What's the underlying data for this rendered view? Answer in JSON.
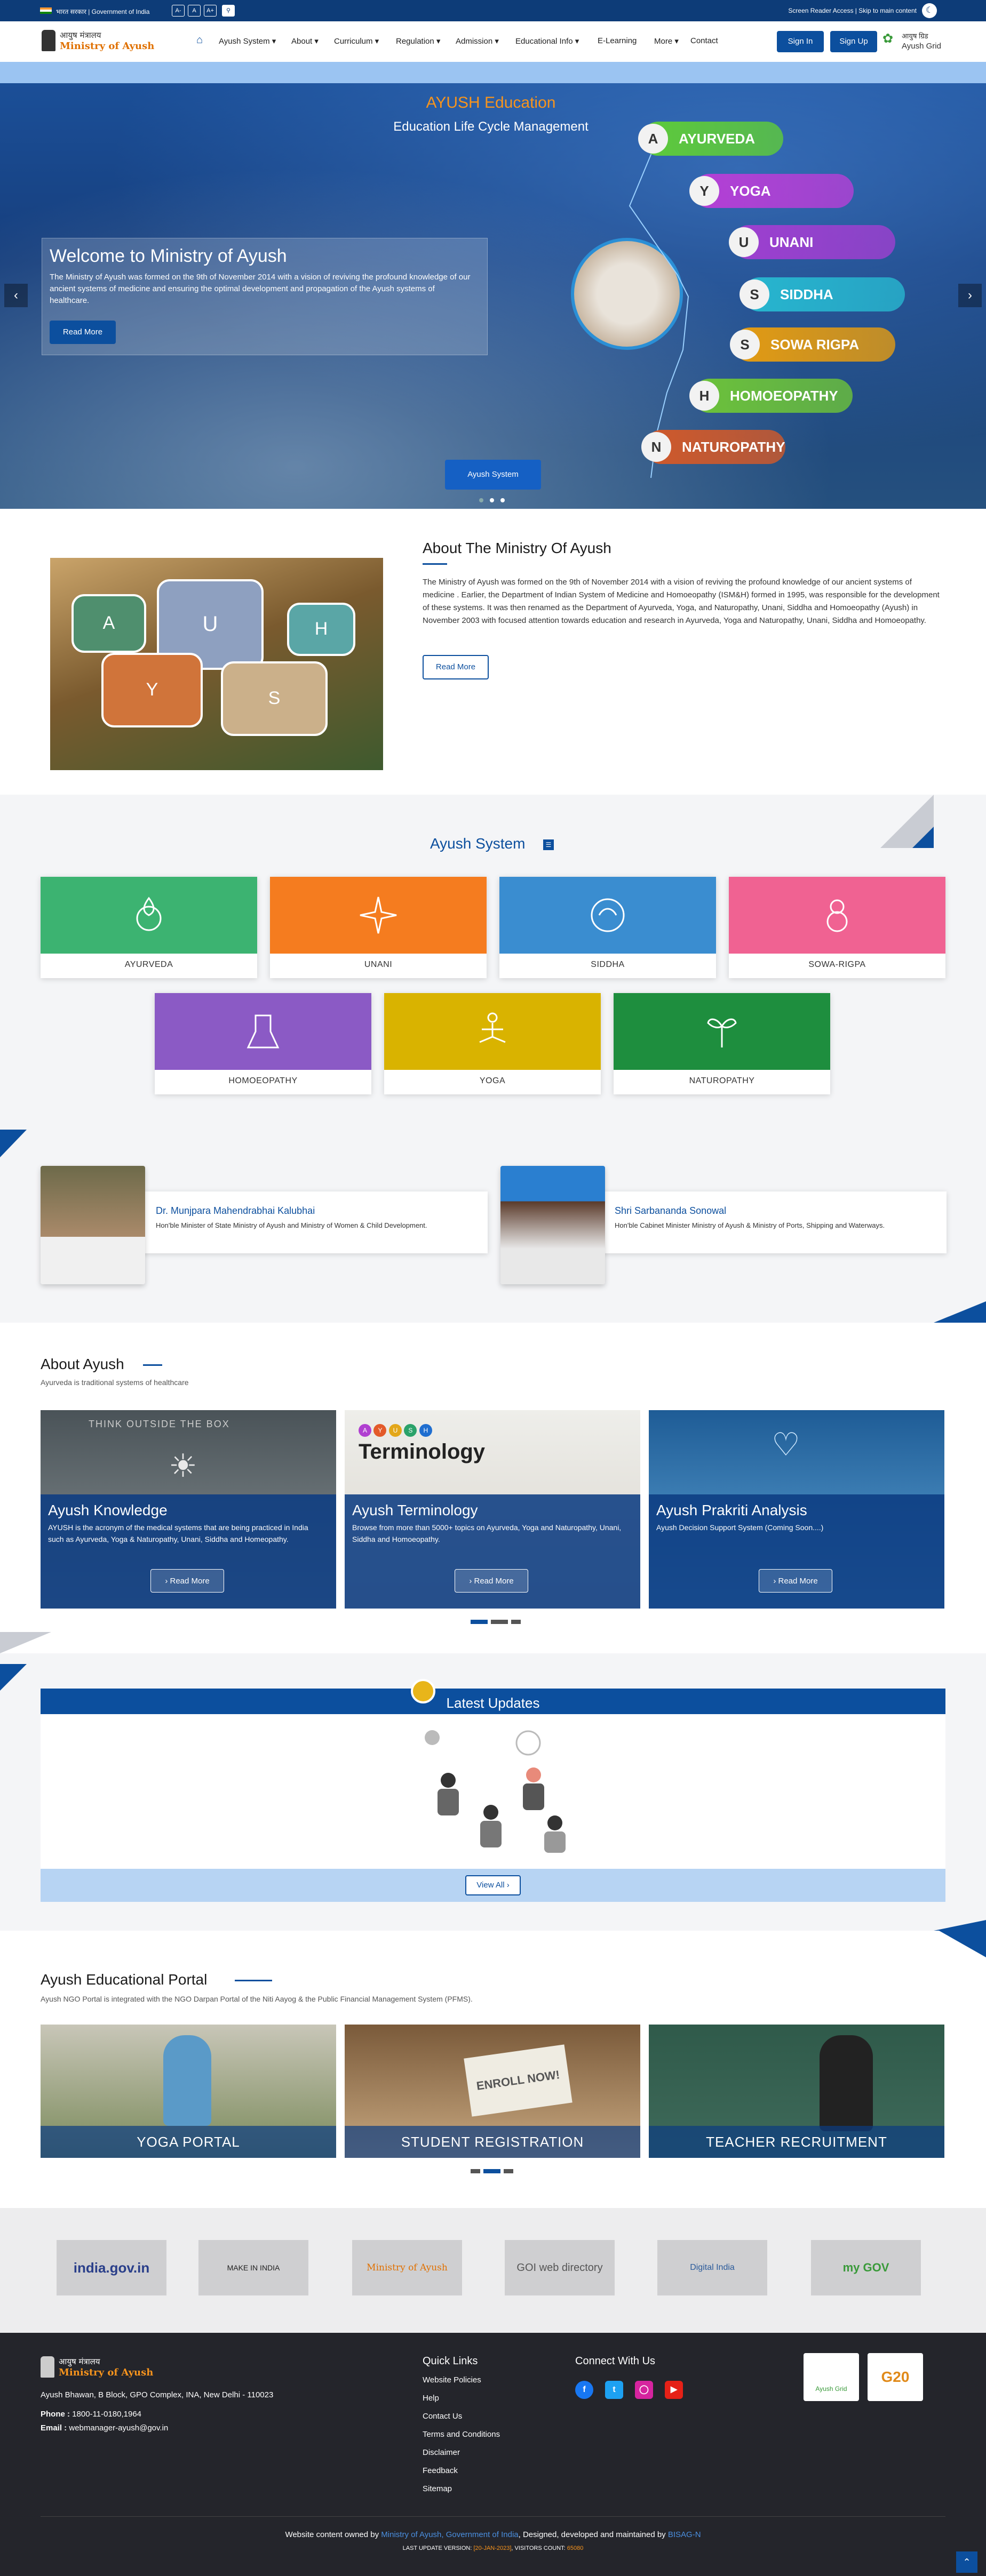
{
  "topbar": {
    "gov_text": "भारत सरकार | Government of India",
    "font_buttons": [
      "A-",
      "A",
      "A+"
    ],
    "screen_reader": "Screen Reader Access",
    "skip": "Skip to main content",
    "sep": "|"
  },
  "header": {
    "logo_hindi": "आयुष मंत्रालय",
    "logo_english": "Ministry of Ayush",
    "home_icon": "home-icon",
    "nav": [
      "Ayush System",
      "About",
      "Curriculum",
      "Regulation",
      "Admission",
      "Educational Info",
      "E-Learning",
      "More",
      "Contact"
    ],
    "sign_in": "Sign In",
    "sign_up": "Sign Up",
    "grid_hindi": "आयुष ग्रिड",
    "grid_english": "Ayush Grid"
  },
  "hero": {
    "title": "AYUSH Education",
    "subtitle": "Education Life Cycle Management",
    "welcome_title": "Welcome to Ministry of Ayush",
    "welcome_text": "The Ministry of Ayush was formed on the 9th of November 2014 with a vision of reviving the profound knowledge of our ancient systems of medicine and ensuring the optimal development and propagation of the Ayush systems of healthcare.",
    "read_more": "Read More",
    "cta": "Ayush System",
    "prev": "‹",
    "next": "›",
    "pills": [
      {
        "letter": "A",
        "name": "AYURVEDA",
        "color": "#5ecb3a"
      },
      {
        "letter": "Y",
        "name": "YOGA",
        "color": "#b53fd6"
      },
      {
        "letter": "U",
        "name": "UNANI",
        "color": "#9e3fd0"
      },
      {
        "letter": "S",
        "name": "SIDDHA",
        "color": "#27b6cf"
      },
      {
        "letter": "S",
        "name": "SOWA RIGPA",
        "color": "#e39b12"
      },
      {
        "letter": "H",
        "name": "HOMOEOPATHY",
        "color": "#6cc23a"
      },
      {
        "letter": "N",
        "name": "NATUROPATHY",
        "color": "#d0592a"
      }
    ]
  },
  "about": {
    "title": "About The Ministry Of Ayush",
    "letters": [
      "A",
      "U",
      "H",
      "Y",
      "S"
    ],
    "text": "The Ministry of Ayush was formed on the 9th of November 2014 with a vision of reviving the profound knowledge of our ancient systems of medicine . Earlier, the Department of Indian System of Medicine and Homoeopathy (ISM&H) formed in 1995, was responsible for the development of these systems. It was then renamed as the Department of Ayurveda, Yoga, and Naturopathy, Unani, Siddha and Homoeopathy (Ayush) in November 2003 with focused attention towards education and research in Ayurveda, Yoga and Naturopathy, Unani, Siddha and Homoeopathy.",
    "read_more": "Read More"
  },
  "ayush_system": {
    "title": "Ayush System",
    "cards": [
      {
        "label": "AYURVEDA",
        "color": "#3cb371"
      },
      {
        "label": "UNANI",
        "color": "#f57c1f"
      },
      {
        "label": "SIDDHA",
        "color": "#3a8dd0"
      },
      {
        "label": "SOWA-RIGPA",
        "color": "#f06292"
      },
      {
        "label": "HOMOEOPATHY",
        "color": "#8b5ac5"
      },
      {
        "label": "YOGA",
        "color": "#d9b300"
      },
      {
        "label": "NATUROPATHY",
        "color": "#1e8e3e"
      }
    ]
  },
  "ministers": [
    {
      "name": "Dr. Munjpara Mahendrabhai Kalubhai",
      "role": "Hon'ble Minister of State Ministry of Ayush and Ministry of Women & Child Development."
    },
    {
      "name": "Shri Sarbananda Sonowal",
      "role": "Hon'ble Cabinet Minister Ministry of Ayush & Ministry of Ports, Shipping and Waterways."
    }
  ],
  "about_ayush": {
    "title": "About Ayush",
    "subtitle": "Ayurveda is traditional systems of healthcare",
    "cards": [
      {
        "title": "Ayush Knowledge",
        "text": "AYUSH is the acronym of the medical systems that are being practiced in India such as Ayurveda, Yoga & Naturopathy, Unani, Siddha and Homeopathy.",
        "btn": "Read More",
        "img_text": "THINK OUTSIDE THE BOX"
      },
      {
        "title": "Ayush Terminology",
        "text": "Browse from more than 5000+ topics on Ayurveda, Yoga and Naturopathy, Unani, Siddha and Homoeopathy.",
        "btn": "Read More",
        "img_text": "Terminology",
        "img_letters": [
          "A",
          "Y",
          "U",
          "S",
          "H"
        ]
      },
      {
        "title": "Ayush Prakriti Analysis",
        "text": "Ayush Decision Support System (Coming Soon....)",
        "btn": "Read More"
      }
    ]
  },
  "updates": {
    "title": "Latest Updates",
    "view_all": "View All"
  },
  "portal": {
    "title": "Ayush Educational Portal",
    "subtitle": "Ayush NGO Portal is integrated with the NGO Darpan Portal of the Niti Aayog & the Public Financial Management System (PFMS).",
    "cards": [
      {
        "label": "YOGA PORTAL"
      },
      {
        "label": "STUDENT REGISTRATION",
        "sign": "ENROLL NOW!"
      },
      {
        "label": "TEACHER RECRUITMENT"
      }
    ]
  },
  "partners": [
    "india.gov.in",
    "MAKE IN INDIA",
    "Ministry of Ayush",
    "GOI web directory",
    "Digital India",
    "my GOV"
  ],
  "footer": {
    "logo_hindi": "आयुष मंत्रालय",
    "logo_english": "Ministry of Ayush",
    "address": "Ayush Bhawan, B Block, GPO Complex, INA, New Delhi - 110023",
    "phone_label": "Phone :",
    "phone": "1800-11-0180,1964",
    "email_label": "Email :",
    "email": "webmanager-ayush@gov.in",
    "quick_title": "Quick Links",
    "links": [
      "Website Policies",
      "Help",
      "Contact Us",
      "Terms and Conditions",
      "Disclaimer",
      "Feedback",
      "Sitemap"
    ],
    "connect_title": "Connect With Us",
    "grid": "Ayush Grid",
    "g20": "G20",
    "owned": "Website content owned by",
    "owner": "Ministry of Ayush, Government of India",
    "maintained": ", Designed, developed and maintained by",
    "bisag": "BISAG-N",
    "update_label": "LAST UPDATE VERSION:",
    "update": "[20-JAN-2023]",
    "visitors_label": "VISITORS COUNT:",
    "visitors": "65080"
  }
}
